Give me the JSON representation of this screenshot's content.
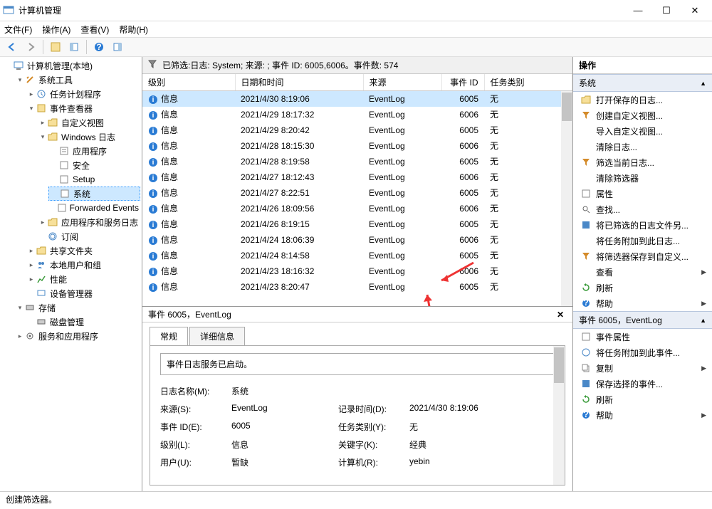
{
  "window": {
    "title": "计算机管理"
  },
  "menu": {
    "file": "文件(F)",
    "action": "操作(A)",
    "view": "查看(V)",
    "help": "帮助(H)"
  },
  "tree": {
    "root": "计算机管理(本地)",
    "system_tools": "系统工具",
    "task_scheduler": "任务计划程序",
    "event_viewer": "事件查看器",
    "custom_views": "自定义视图",
    "windows_logs": "Windows 日志",
    "application": "应用程序",
    "security": "安全",
    "setup": "Setup",
    "system": "系统",
    "forwarded": "Forwarded Events",
    "app_svc_logs": "应用程序和服务日志",
    "subscriptions": "订阅",
    "shared_folders": "共享文件夹",
    "local_users": "本地用户和组",
    "performance": "性能",
    "device_mgr": "设备管理器",
    "storage": "存储",
    "disk_mgmt": "磁盘管理",
    "services_apps": "服务和应用程序"
  },
  "filter": {
    "text": "已筛选:日志: System; 来源: ; 事件 ID: 6005,6006。事件数: 574"
  },
  "columns": {
    "level": "级别",
    "datetime": "日期和时间",
    "source": "来源",
    "eventid": "事件 ID",
    "taskcat": "任务类别"
  },
  "rows": [
    {
      "level": "信息",
      "dt": "2021/4/30 8:19:06",
      "src": "EventLog",
      "id": "6005",
      "task": "无",
      "selected": true
    },
    {
      "level": "信息",
      "dt": "2021/4/29 18:17:32",
      "src": "EventLog",
      "id": "6006",
      "task": "无"
    },
    {
      "level": "信息",
      "dt": "2021/4/29 8:20:42",
      "src": "EventLog",
      "id": "6005",
      "task": "无"
    },
    {
      "level": "信息",
      "dt": "2021/4/28 18:15:30",
      "src": "EventLog",
      "id": "6006",
      "task": "无"
    },
    {
      "level": "信息",
      "dt": "2021/4/28 8:19:58",
      "src": "EventLog",
      "id": "6005",
      "task": "无"
    },
    {
      "level": "信息",
      "dt": "2021/4/27 18:12:43",
      "src": "EventLog",
      "id": "6006",
      "task": "无"
    },
    {
      "level": "信息",
      "dt": "2021/4/27 8:22:51",
      "src": "EventLog",
      "id": "6005",
      "task": "无"
    },
    {
      "level": "信息",
      "dt": "2021/4/26 18:09:56",
      "src": "EventLog",
      "id": "6006",
      "task": "无"
    },
    {
      "level": "信息",
      "dt": "2021/4/26 8:19:15",
      "src": "EventLog",
      "id": "6005",
      "task": "无"
    },
    {
      "level": "信息",
      "dt": "2021/4/24 18:06:39",
      "src": "EventLog",
      "id": "6006",
      "task": "无"
    },
    {
      "level": "信息",
      "dt": "2021/4/24 8:14:58",
      "src": "EventLog",
      "id": "6005",
      "task": "无"
    },
    {
      "level": "信息",
      "dt": "2021/4/23 18:16:32",
      "src": "EventLog",
      "id": "6006",
      "task": "无"
    },
    {
      "level": "信息",
      "dt": "2021/4/23 8:20:47",
      "src": "EventLog",
      "id": "6005",
      "task": "无"
    }
  ],
  "detail": {
    "header": "事件 6005，EventLog",
    "tab_general": "常规",
    "tab_details": "详细信息",
    "message": "事件日志服务已启动。",
    "labels": {
      "logname": "日志名称(M):",
      "source": "来源(S):",
      "eventid": "事件 ID(E):",
      "level": "级别(L):",
      "user": "用户(U):",
      "logged": "记录时间(D):",
      "taskcat": "任务类别(Y):",
      "keywords": "关键字(K):",
      "computer": "计算机(R):"
    },
    "values": {
      "logname": "系统",
      "source": "EventLog",
      "eventid": "6005",
      "level": "信息",
      "user": "暂缺",
      "logged": "2021/4/30 8:19:06",
      "taskcat": "无",
      "keywords": "经典",
      "computer": "yebin"
    }
  },
  "actions": {
    "title": "操作",
    "section1": "系统",
    "open_saved": "打开保存的日志...",
    "create_view": "创建自定义视图...",
    "import_view": "导入自定义视图...",
    "clear_log": "清除日志...",
    "filter_current": "筛选当前日志...",
    "clear_filter": "清除筛选器",
    "properties": "属性",
    "find": "查找...",
    "save_filtered": "将已筛选的日志文件另...",
    "attach_task_log": "将任务附加到此日志...",
    "save_filter_custom": "将筛选器保存到自定义...",
    "view": "查看",
    "refresh": "刷新",
    "help": "帮助",
    "section2": "事件 6005，EventLog",
    "event_props": "事件属性",
    "attach_task_event": "将任务附加到此事件...",
    "copy": "复制",
    "save_selected": "保存选择的事件...",
    "refresh2": "刷新",
    "help2": "帮助"
  },
  "status": {
    "text": "创建筛选器。"
  }
}
